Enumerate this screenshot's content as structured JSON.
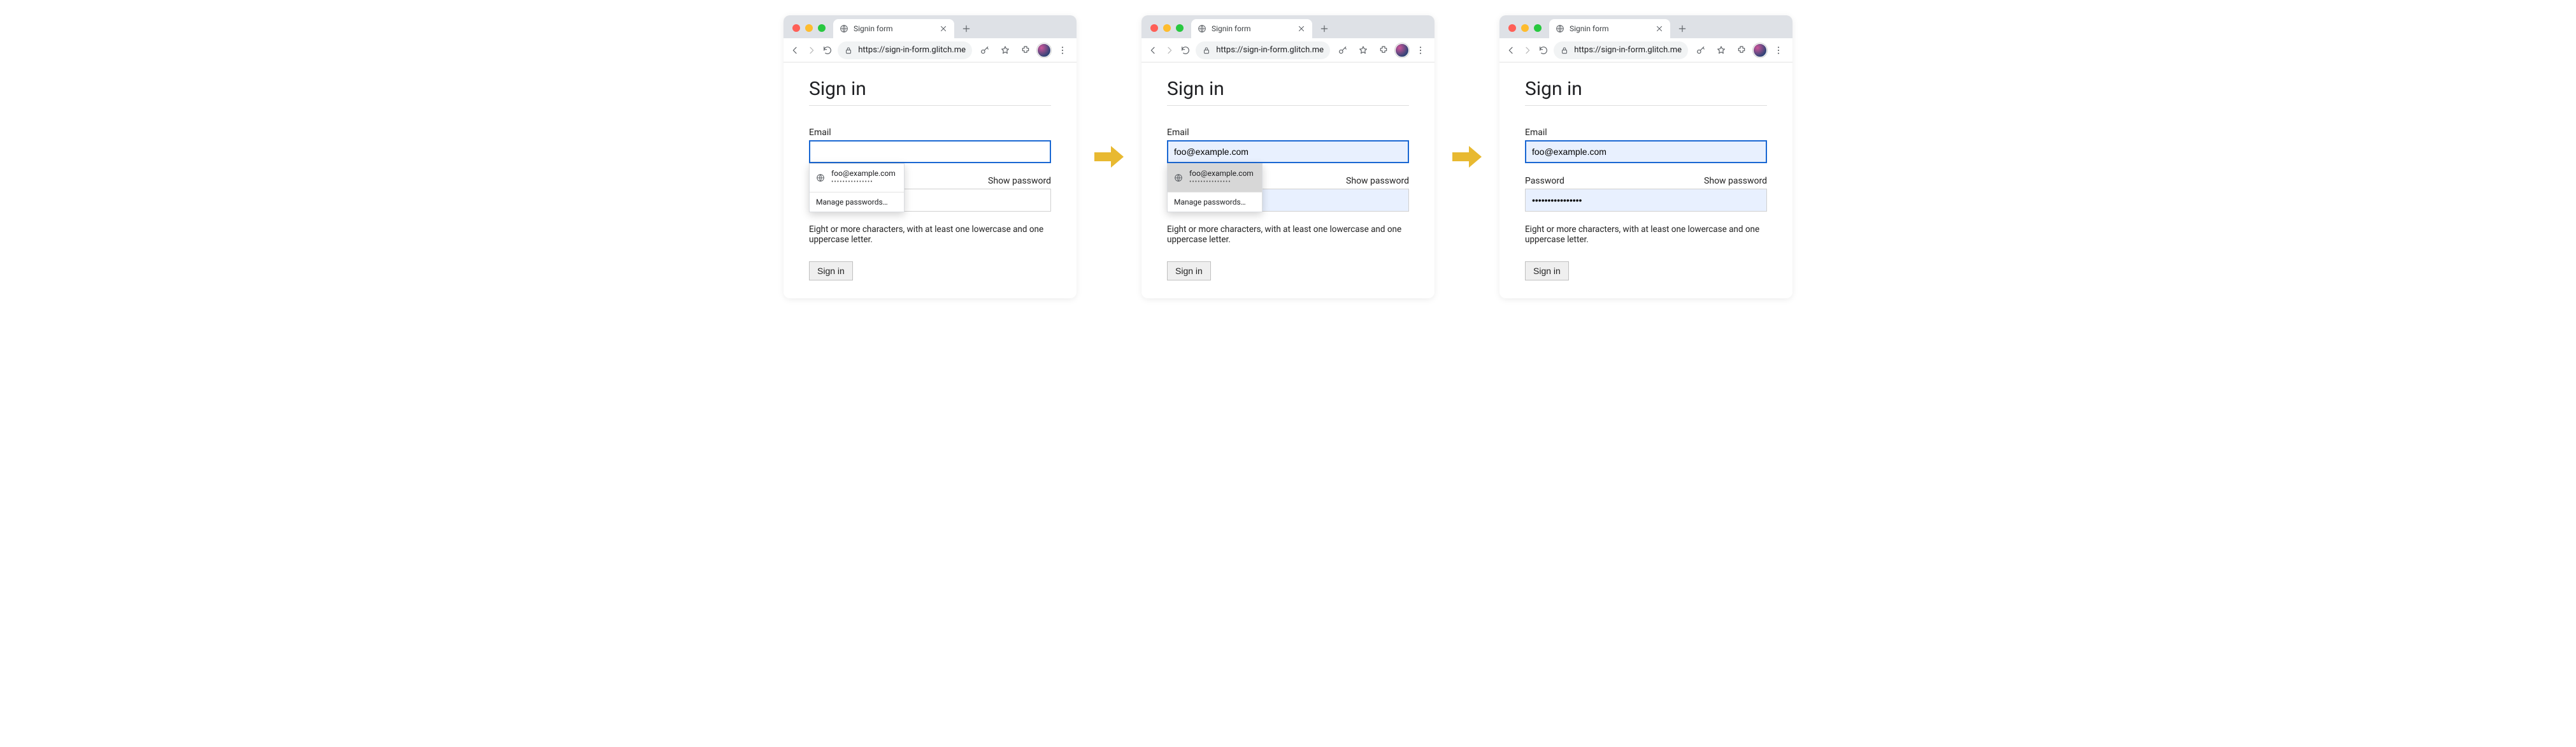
{
  "browser": {
    "tab_title": "Signin form",
    "url": "https://sign-in-form.glitch.me",
    "icons": {
      "globe": "globe-icon",
      "close": "close-icon",
      "newtab": "plus-icon",
      "back": "back-icon",
      "forward": "forward-icon",
      "reload": "reload-icon",
      "lock": "lock-icon",
      "key": "key-icon",
      "star": "star-icon",
      "ext": "extension-icon",
      "avatar": "avatar",
      "menu": "dots-menu-icon"
    }
  },
  "page": {
    "heading": "Sign in",
    "email_label": "Email",
    "password_label": "Password",
    "show_password": "Show password",
    "hint": "Eight or more characters, with at least one lowercase and one uppercase letter.",
    "signin_button": "Sign in"
  },
  "autofill": {
    "suggestion_email": "foo@example.com",
    "suggestion_password_dots": "•••••••••••••••",
    "manage_label": "Manage passwords…"
  },
  "states": {
    "s1": {
      "email_value": "",
      "password_value": "",
      "suggestion_highlight": false,
      "show_dropdown": true
    },
    "s2": {
      "email_value": "foo@example.com",
      "password_value": "••••••••••••••••",
      "suggestion_highlight": true,
      "show_dropdown": true
    },
    "s3": {
      "email_value": "foo@example.com",
      "password_value": "••••••••••••••••",
      "suggestion_highlight": false,
      "show_dropdown": false
    }
  }
}
